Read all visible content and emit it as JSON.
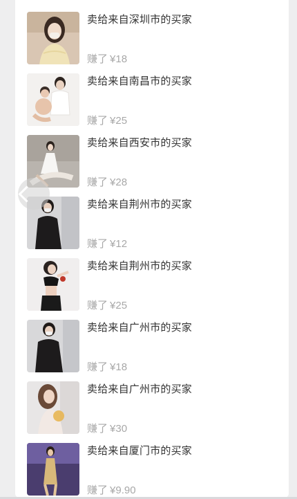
{
  "sales": [
    {
      "title": "卖给来自深圳市的买家",
      "earn_label": "赚了",
      "currency": "¥",
      "amount": "18"
    },
    {
      "title": "卖给来自南昌市的买家",
      "earn_label": "赚了",
      "currency": "¥",
      "amount": "25"
    },
    {
      "title": "卖给来自西安市的买家",
      "earn_label": "赚了",
      "currency": "¥",
      "amount": "28"
    },
    {
      "title": "卖给来自荆州市的买家",
      "earn_label": "赚了",
      "currency": "¥",
      "amount": "12"
    },
    {
      "title": "卖给来自荆州市的买家",
      "earn_label": "赚了",
      "currency": "¥",
      "amount": "25"
    },
    {
      "title": "卖给来自广州市的买家",
      "earn_label": "赚了",
      "currency": "¥",
      "amount": "18"
    },
    {
      "title": "卖给来自广州市的买家",
      "earn_label": "赚了",
      "currency": "¥",
      "amount": "30"
    },
    {
      "title": "卖给来自厦门市的买家",
      "earn_label": "赚了",
      "currency": "¥",
      "amount": "9.90"
    }
  ],
  "colors": {
    "title": "#333333",
    "earn": "#a8a8a8",
    "background": "#eeeeef",
    "card": "#ffffff"
  },
  "icons": {
    "back": "chevron-left-icon"
  }
}
